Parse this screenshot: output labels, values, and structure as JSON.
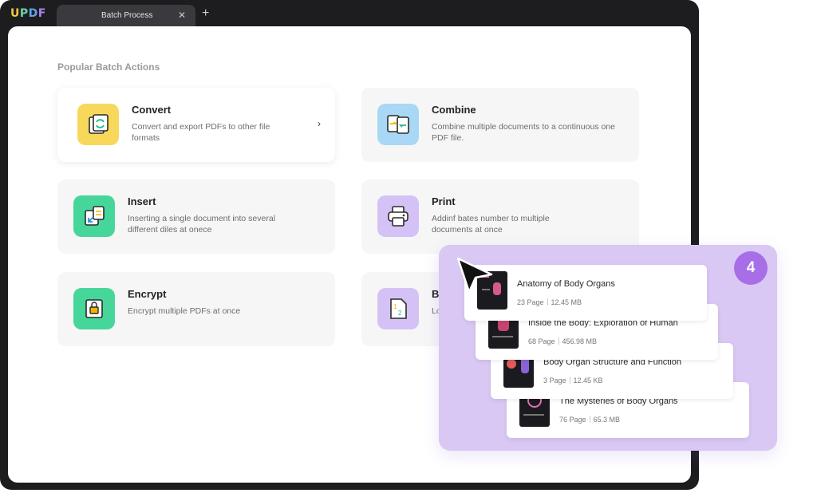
{
  "app": {
    "logo": "UPDF"
  },
  "tabs": [
    {
      "label": "Batch Process"
    }
  ],
  "main": {
    "section_title": "Popular Batch Actions"
  },
  "cards": [
    {
      "title": "Convert",
      "desc": "Convert and export PDFs to other file formats",
      "icon": "convert-icon",
      "color": "#f8d85a"
    },
    {
      "title": "Combine",
      "desc": "Combine multiple documents to a continuous one PDF file.",
      "icon": "combine-icon",
      "color": "#a8d8f5"
    },
    {
      "title": "Insert",
      "desc": "Inserting a single document into several different diles at onece",
      "icon": "insert-icon",
      "color": "#46d69a"
    },
    {
      "title": "Print",
      "desc": "Addinf bates number to multiple documents at once",
      "icon": "print-icon",
      "color": "#d4c2f6"
    },
    {
      "title": "Encrypt",
      "desc": "Encrypt multiple PDFs at once",
      "icon": "lock-icon",
      "color": "#46d69a"
    },
    {
      "title": "Ba",
      "desc": "Lo co",
      "icon": "bates-icon",
      "color": "#d4c2f6"
    }
  ],
  "overlay": {
    "step": "4",
    "files": [
      {
        "name": "Anatomy of Body Organs",
        "pages": "23 Page",
        "size": "12.45 MB"
      },
      {
        "name": "Inside the Body: Exploration of Human",
        "pages": "68 Page",
        "size": "456.98 MB"
      },
      {
        "name": "Body Organ Structure and Function",
        "pages": "3 Page",
        "size": "12.45 KB"
      },
      {
        "name": "The Mysteries of Body Organs",
        "pages": "76 Page",
        "size": "65.3 MB"
      }
    ]
  },
  "colors": {
    "frame": "#1d1d20",
    "panel": "#d9c7f4",
    "badge": "#a86ee8"
  }
}
